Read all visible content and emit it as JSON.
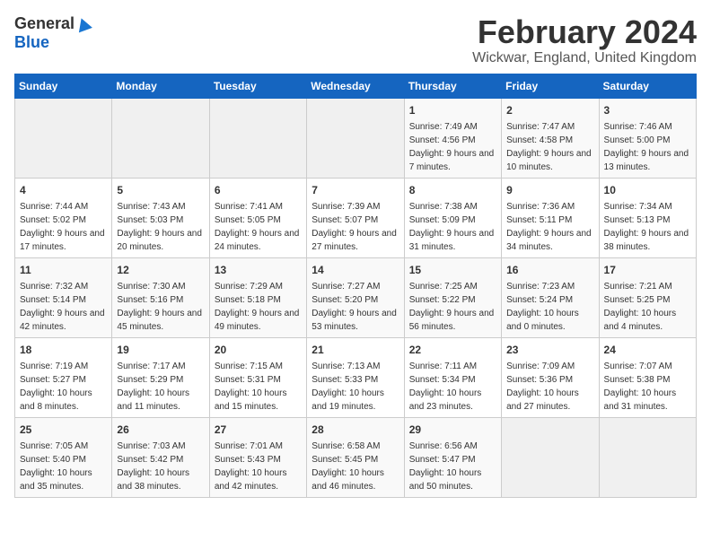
{
  "logo": {
    "general": "General",
    "blue": "Blue"
  },
  "title": "February 2024",
  "location": "Wickwar, England, United Kingdom",
  "days_of_week": [
    "Sunday",
    "Monday",
    "Tuesday",
    "Wednesday",
    "Thursday",
    "Friday",
    "Saturday"
  ],
  "weeks": [
    [
      {
        "day": "",
        "sunrise": "",
        "sunset": "",
        "daylight": ""
      },
      {
        "day": "",
        "sunrise": "",
        "sunset": "",
        "daylight": ""
      },
      {
        "day": "",
        "sunrise": "",
        "sunset": "",
        "daylight": ""
      },
      {
        "day": "",
        "sunrise": "",
        "sunset": "",
        "daylight": ""
      },
      {
        "day": "1",
        "sunrise": "Sunrise: 7:49 AM",
        "sunset": "Sunset: 4:56 PM",
        "daylight": "Daylight: 9 hours and 7 minutes."
      },
      {
        "day": "2",
        "sunrise": "Sunrise: 7:47 AM",
        "sunset": "Sunset: 4:58 PM",
        "daylight": "Daylight: 9 hours and 10 minutes."
      },
      {
        "day": "3",
        "sunrise": "Sunrise: 7:46 AM",
        "sunset": "Sunset: 5:00 PM",
        "daylight": "Daylight: 9 hours and 13 minutes."
      }
    ],
    [
      {
        "day": "4",
        "sunrise": "Sunrise: 7:44 AM",
        "sunset": "Sunset: 5:02 PM",
        "daylight": "Daylight: 9 hours and 17 minutes."
      },
      {
        "day": "5",
        "sunrise": "Sunrise: 7:43 AM",
        "sunset": "Sunset: 5:03 PM",
        "daylight": "Daylight: 9 hours and 20 minutes."
      },
      {
        "day": "6",
        "sunrise": "Sunrise: 7:41 AM",
        "sunset": "Sunset: 5:05 PM",
        "daylight": "Daylight: 9 hours and 24 minutes."
      },
      {
        "day": "7",
        "sunrise": "Sunrise: 7:39 AM",
        "sunset": "Sunset: 5:07 PM",
        "daylight": "Daylight: 9 hours and 27 minutes."
      },
      {
        "day": "8",
        "sunrise": "Sunrise: 7:38 AM",
        "sunset": "Sunset: 5:09 PM",
        "daylight": "Daylight: 9 hours and 31 minutes."
      },
      {
        "day": "9",
        "sunrise": "Sunrise: 7:36 AM",
        "sunset": "Sunset: 5:11 PM",
        "daylight": "Daylight: 9 hours and 34 minutes."
      },
      {
        "day": "10",
        "sunrise": "Sunrise: 7:34 AM",
        "sunset": "Sunset: 5:13 PM",
        "daylight": "Daylight: 9 hours and 38 minutes."
      }
    ],
    [
      {
        "day": "11",
        "sunrise": "Sunrise: 7:32 AM",
        "sunset": "Sunset: 5:14 PM",
        "daylight": "Daylight: 9 hours and 42 minutes."
      },
      {
        "day": "12",
        "sunrise": "Sunrise: 7:30 AM",
        "sunset": "Sunset: 5:16 PM",
        "daylight": "Daylight: 9 hours and 45 minutes."
      },
      {
        "day": "13",
        "sunrise": "Sunrise: 7:29 AM",
        "sunset": "Sunset: 5:18 PM",
        "daylight": "Daylight: 9 hours and 49 minutes."
      },
      {
        "day": "14",
        "sunrise": "Sunrise: 7:27 AM",
        "sunset": "Sunset: 5:20 PM",
        "daylight": "Daylight: 9 hours and 53 minutes."
      },
      {
        "day": "15",
        "sunrise": "Sunrise: 7:25 AM",
        "sunset": "Sunset: 5:22 PM",
        "daylight": "Daylight: 9 hours and 56 minutes."
      },
      {
        "day": "16",
        "sunrise": "Sunrise: 7:23 AM",
        "sunset": "Sunset: 5:24 PM",
        "daylight": "Daylight: 10 hours and 0 minutes."
      },
      {
        "day": "17",
        "sunrise": "Sunrise: 7:21 AM",
        "sunset": "Sunset: 5:25 PM",
        "daylight": "Daylight: 10 hours and 4 minutes."
      }
    ],
    [
      {
        "day": "18",
        "sunrise": "Sunrise: 7:19 AM",
        "sunset": "Sunset: 5:27 PM",
        "daylight": "Daylight: 10 hours and 8 minutes."
      },
      {
        "day": "19",
        "sunrise": "Sunrise: 7:17 AM",
        "sunset": "Sunset: 5:29 PM",
        "daylight": "Daylight: 10 hours and 11 minutes."
      },
      {
        "day": "20",
        "sunrise": "Sunrise: 7:15 AM",
        "sunset": "Sunset: 5:31 PM",
        "daylight": "Daylight: 10 hours and 15 minutes."
      },
      {
        "day": "21",
        "sunrise": "Sunrise: 7:13 AM",
        "sunset": "Sunset: 5:33 PM",
        "daylight": "Daylight: 10 hours and 19 minutes."
      },
      {
        "day": "22",
        "sunrise": "Sunrise: 7:11 AM",
        "sunset": "Sunset: 5:34 PM",
        "daylight": "Daylight: 10 hours and 23 minutes."
      },
      {
        "day": "23",
        "sunrise": "Sunrise: 7:09 AM",
        "sunset": "Sunset: 5:36 PM",
        "daylight": "Daylight: 10 hours and 27 minutes."
      },
      {
        "day": "24",
        "sunrise": "Sunrise: 7:07 AM",
        "sunset": "Sunset: 5:38 PM",
        "daylight": "Daylight: 10 hours and 31 minutes."
      }
    ],
    [
      {
        "day": "25",
        "sunrise": "Sunrise: 7:05 AM",
        "sunset": "Sunset: 5:40 PM",
        "daylight": "Daylight: 10 hours and 35 minutes."
      },
      {
        "day": "26",
        "sunrise": "Sunrise: 7:03 AM",
        "sunset": "Sunset: 5:42 PM",
        "daylight": "Daylight: 10 hours and 38 minutes."
      },
      {
        "day": "27",
        "sunrise": "Sunrise: 7:01 AM",
        "sunset": "Sunset: 5:43 PM",
        "daylight": "Daylight: 10 hours and 42 minutes."
      },
      {
        "day": "28",
        "sunrise": "Sunrise: 6:58 AM",
        "sunset": "Sunset: 5:45 PM",
        "daylight": "Daylight: 10 hours and 46 minutes."
      },
      {
        "day": "29",
        "sunrise": "Sunrise: 6:56 AM",
        "sunset": "Sunset: 5:47 PM",
        "daylight": "Daylight: 10 hours and 50 minutes."
      },
      {
        "day": "",
        "sunrise": "",
        "sunset": "",
        "daylight": ""
      },
      {
        "day": "",
        "sunrise": "",
        "sunset": "",
        "daylight": ""
      }
    ]
  ]
}
